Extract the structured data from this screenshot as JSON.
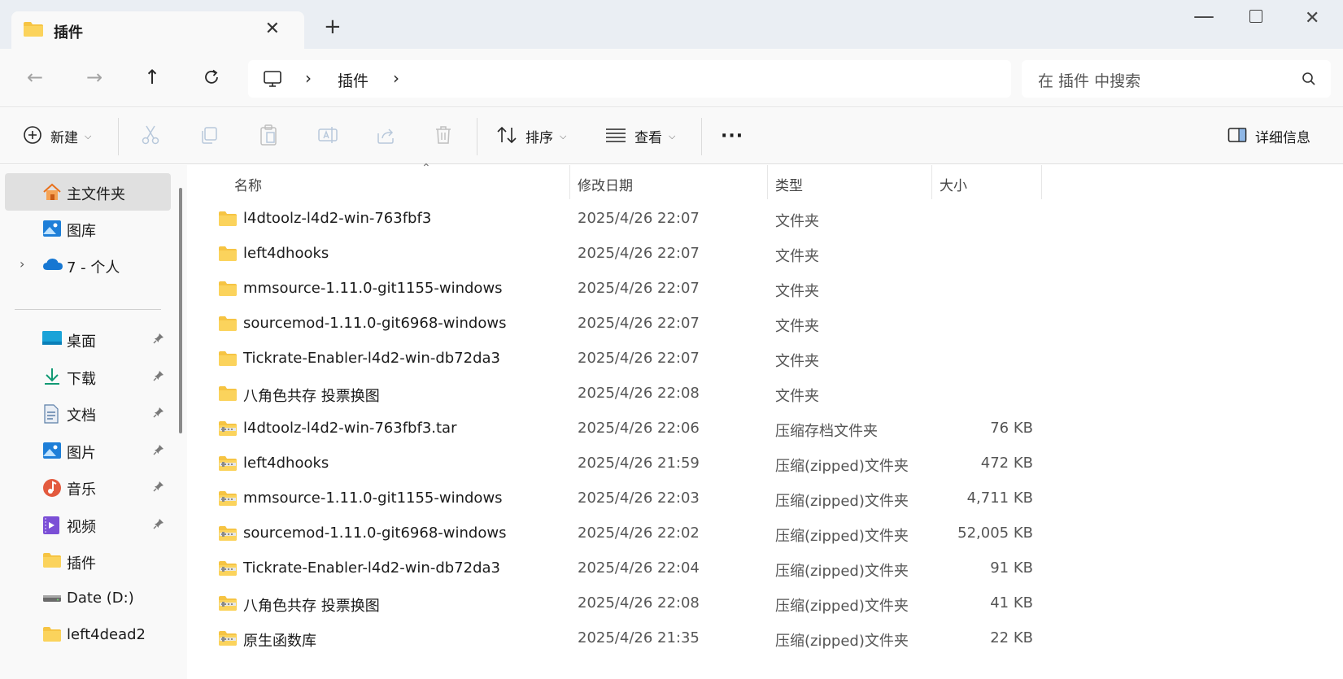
{
  "tab": {
    "title": "插件"
  },
  "address": {
    "crumbs": [
      "插件"
    ]
  },
  "search": {
    "placeholder": "在 插件 中搜索"
  },
  "toolbar": {
    "new_label": "新建",
    "sort_label": "排序",
    "view_label": "查看",
    "more_label": "···",
    "details_label": "详细信息"
  },
  "sidebar": {
    "items": [
      {
        "label": "主文件夹",
        "icon": "home-icon"
      },
      {
        "label": "图库",
        "icon": "gallery-icon"
      },
      {
        "label": "7 - 个人",
        "icon": "onedrive-cloud-icon"
      },
      {
        "label": "桌面",
        "icon": "desktop-icon"
      },
      {
        "label": "下载",
        "icon": "download-icon"
      },
      {
        "label": "文档",
        "icon": "documents-icon"
      },
      {
        "label": "图片",
        "icon": "pictures-icon"
      },
      {
        "label": "音乐",
        "icon": "music-icon"
      },
      {
        "label": "视频",
        "icon": "videos-icon"
      },
      {
        "label": "插件",
        "icon": "folder-icon"
      },
      {
        "label": "Date (D:)",
        "icon": "drive-icon"
      },
      {
        "label": "left4dead2",
        "icon": "folder-icon"
      }
    ]
  },
  "columns": {
    "name": "名称",
    "date": "修改日期",
    "type": "类型",
    "size": "大小"
  },
  "files": [
    {
      "name": "l4dtoolz-l4d2-win-763fbf3",
      "date": "2025/4/26 22:07",
      "type": "文件夹",
      "size": "",
      "kind": "folder"
    },
    {
      "name": "left4dhooks",
      "date": "2025/4/26 22:07",
      "type": "文件夹",
      "size": "",
      "kind": "folder"
    },
    {
      "name": "mmsource-1.11.0-git1155-windows",
      "date": "2025/4/26 22:07",
      "type": "文件夹",
      "size": "",
      "kind": "folder"
    },
    {
      "name": "sourcemod-1.11.0-git6968-windows",
      "date": "2025/4/26 22:07",
      "type": "文件夹",
      "size": "",
      "kind": "folder"
    },
    {
      "name": "Tickrate-Enabler-l4d2-win-db72da3",
      "date": "2025/4/26 22:07",
      "type": "文件夹",
      "size": "",
      "kind": "folder"
    },
    {
      "name": "八角色共存 投票换图",
      "date": "2025/4/26 22:08",
      "type": "文件夹",
      "size": "",
      "kind": "folder"
    },
    {
      "name": "l4dtoolz-l4d2-win-763fbf3.tar",
      "date": "2025/4/26 22:06",
      "type": "压缩存档文件夹",
      "size": "76 KB",
      "kind": "zip"
    },
    {
      "name": "left4dhooks",
      "date": "2025/4/26 21:59",
      "type": "压缩(zipped)文件夹",
      "size": "472 KB",
      "kind": "zip"
    },
    {
      "name": "mmsource-1.11.0-git1155-windows",
      "date": "2025/4/26 22:03",
      "type": "压缩(zipped)文件夹",
      "size": "4,711 KB",
      "kind": "zip"
    },
    {
      "name": "sourcemod-1.11.0-git6968-windows",
      "date": "2025/4/26 22:02",
      "type": "压缩(zipped)文件夹",
      "size": "52,005 KB",
      "kind": "zip"
    },
    {
      "name": "Tickrate-Enabler-l4d2-win-db72da3",
      "date": "2025/4/26 22:04",
      "type": "压缩(zipped)文件夹",
      "size": "91 KB",
      "kind": "zip"
    },
    {
      "name": "八角色共存 投票换图",
      "date": "2025/4/26 22:08",
      "type": "压缩(zipped)文件夹",
      "size": "41 KB",
      "kind": "zip"
    },
    {
      "name": "原生函数库",
      "date": "2025/4/26 21:35",
      "type": "压缩(zipped)文件夹",
      "size": "22 KB",
      "kind": "zip"
    }
  ],
  "colors": {
    "folder": "#f6c443",
    "folder_dark": "#e7a92b",
    "accent": "#005fb8",
    "selected_bg": "#e0e0e0"
  }
}
